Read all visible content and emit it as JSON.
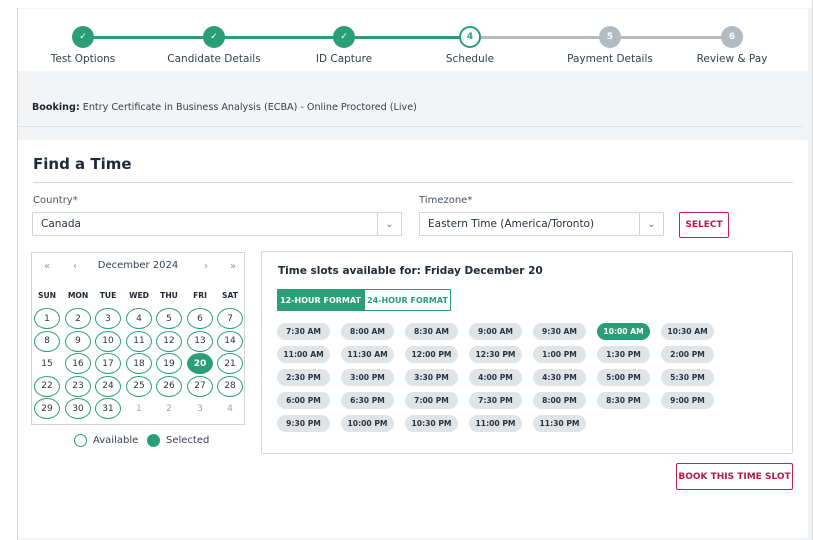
{
  "steps": [
    {
      "label": "Test Options",
      "state": "done",
      "marker": "✓"
    },
    {
      "label": "Candidate Details",
      "state": "done",
      "marker": "✓"
    },
    {
      "label": "ID Capture",
      "state": "done",
      "marker": "✓"
    },
    {
      "label": "Schedule",
      "state": "current",
      "marker": "4"
    },
    {
      "label": "Payment Details",
      "state": "todo",
      "marker": "5"
    },
    {
      "label": "Review & Pay",
      "state": "todo",
      "marker": "6"
    }
  ],
  "booking": {
    "prefix": "Booking:",
    "text": "Entry Certificate in Business Analysis (ECBA) - Online Proctored (Live)"
  },
  "find": {
    "title": "Find a Time",
    "country_label": "Country*",
    "country_value": "Canada",
    "timezone_label": "Timezone*",
    "timezone_value": "Eastern Time (America/Toronto)",
    "select_button": "SELECT"
  },
  "calendar": {
    "prev_year": "«",
    "prev_month": "‹",
    "month": "December 2024",
    "next_month": "›",
    "next_year": "»",
    "weekdays": [
      "SUN",
      "MON",
      "TUE",
      "WED",
      "THU",
      "FRI",
      "SAT"
    ],
    "weeks": [
      [
        {
          "d": "1",
          "s": "avail"
        },
        {
          "d": "2",
          "s": "avail"
        },
        {
          "d": "3",
          "s": "avail"
        },
        {
          "d": "4",
          "s": "avail"
        },
        {
          "d": "5",
          "s": "avail"
        },
        {
          "d": "6",
          "s": "avail"
        },
        {
          "d": "7",
          "s": "avail"
        }
      ],
      [
        {
          "d": "8",
          "s": "avail"
        },
        {
          "d": "9",
          "s": "avail"
        },
        {
          "d": "10",
          "s": "avail"
        },
        {
          "d": "11",
          "s": "avail"
        },
        {
          "d": "12",
          "s": "avail"
        },
        {
          "d": "13",
          "s": "avail"
        },
        {
          "d": "14",
          "s": "avail"
        }
      ],
      [
        {
          "d": "15",
          "s": "plain"
        },
        {
          "d": "16",
          "s": "avail"
        },
        {
          "d": "17",
          "s": "avail"
        },
        {
          "d": "18",
          "s": "avail"
        },
        {
          "d": "19",
          "s": "avail"
        },
        {
          "d": "20",
          "s": "sel"
        },
        {
          "d": "21",
          "s": "avail"
        }
      ],
      [
        {
          "d": "22",
          "s": "avail"
        },
        {
          "d": "23",
          "s": "avail"
        },
        {
          "d": "24",
          "s": "avail"
        },
        {
          "d": "25",
          "s": "avail"
        },
        {
          "d": "26",
          "s": "avail"
        },
        {
          "d": "27",
          "s": "avail"
        },
        {
          "d": "28",
          "s": "avail"
        }
      ],
      [
        {
          "d": "29",
          "s": "avail"
        },
        {
          "d": "30",
          "s": "avail"
        },
        {
          "d": "31",
          "s": "avail"
        },
        {
          "d": "1",
          "s": "muted"
        },
        {
          "d": "2",
          "s": "muted"
        },
        {
          "d": "3",
          "s": "muted"
        },
        {
          "d": "4",
          "s": "muted"
        }
      ]
    ],
    "legend_available": "Available",
    "legend_selected": "Selected"
  },
  "slots": {
    "title": "Time slots available for: Friday December 20",
    "format_12": "12-HOUR FORMAT",
    "format_24": "24-HOUR FORMAT",
    "selected": "10:00 AM",
    "times": [
      "7:30 AM",
      "8:00 AM",
      "8:30 AM",
      "9:00 AM",
      "9:30 AM",
      "10:00 AM",
      "10:30 AM",
      "11:00 AM",
      "11:30 AM",
      "12:00 PM",
      "12:30 PM",
      "1:00 PM",
      "1:30 PM",
      "2:00 PM",
      "2:30 PM",
      "3:00 PM",
      "3:30 PM",
      "4:00 PM",
      "4:30 PM",
      "5:00 PM",
      "5:30 PM",
      "6:00 PM",
      "6:30 PM",
      "7:00 PM",
      "7:30 PM",
      "8:00 PM",
      "8:30 PM",
      "9:00 PM",
      "9:30 PM",
      "10:00 PM",
      "10:30 PM",
      "11:00 PM",
      "11:30 PM"
    ],
    "book_button": "BOOK THIS TIME SLOT"
  },
  "colors": {
    "accent": "#2a9f77",
    "action": "#c0244e",
    "inactive": "#b3bbc2"
  }
}
